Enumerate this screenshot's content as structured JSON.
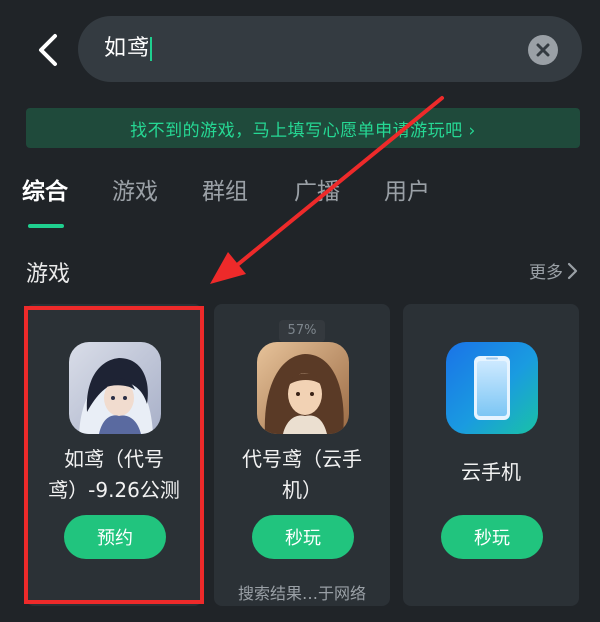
{
  "search": {
    "query": "如鸢"
  },
  "icons": {
    "back": "back-arrow-icon",
    "clear": "clear-icon",
    "more": "chevron-right-icon"
  },
  "wish_banner": {
    "text": "找不到的游戏，马上填写心愿单申请游玩吧 ›"
  },
  "tabs": [
    {
      "label": "综合",
      "active": true
    },
    {
      "label": "游戏",
      "active": false
    },
    {
      "label": "群组",
      "active": false
    },
    {
      "label": "广播",
      "active": false
    },
    {
      "label": "用户",
      "active": false
    }
  ],
  "section": {
    "title": "游戏",
    "more_label": "更多"
  },
  "cards": [
    {
      "name_line1": "如鸢（代号",
      "name_line2": "鸢）-9.26公测",
      "button": "预约"
    },
    {
      "name_line1": "代号鸢（云手",
      "name_line2": "机）",
      "button": "秒玩",
      "badge": "57%"
    },
    {
      "name_line1": "云手机",
      "name_line2": "",
      "button": "秒玩"
    }
  ],
  "source_note": "搜索结果…于网络",
  "colors": {
    "accent": "#21c47e",
    "banner_text": "#26d894",
    "annotation": "#ee2a2a",
    "background": "#202428"
  }
}
